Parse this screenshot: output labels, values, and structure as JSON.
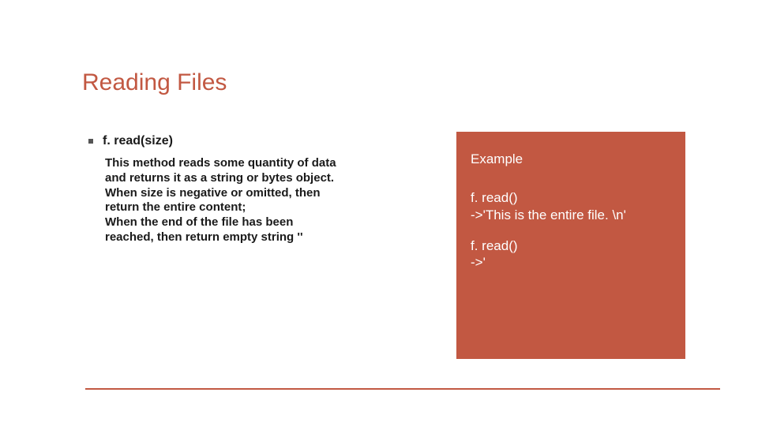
{
  "title": "Reading Files",
  "bullet_heading": "f. read(size)",
  "body": {
    "l1": "This method reads some quantity of data",
    "l2": "and returns it as a string or bytes object.",
    "l3": "When size is negative or omitted, then",
    "l4": "return the entire content;",
    "l5": "When the end of the file has been",
    "l6": "reached, then return empty string ''"
  },
  "example": {
    "heading": "Example",
    "l1": "f. read()",
    "l2": "->'This is the entire file. \\n'",
    "l3": " f. read()",
    "l4": "->'"
  }
}
